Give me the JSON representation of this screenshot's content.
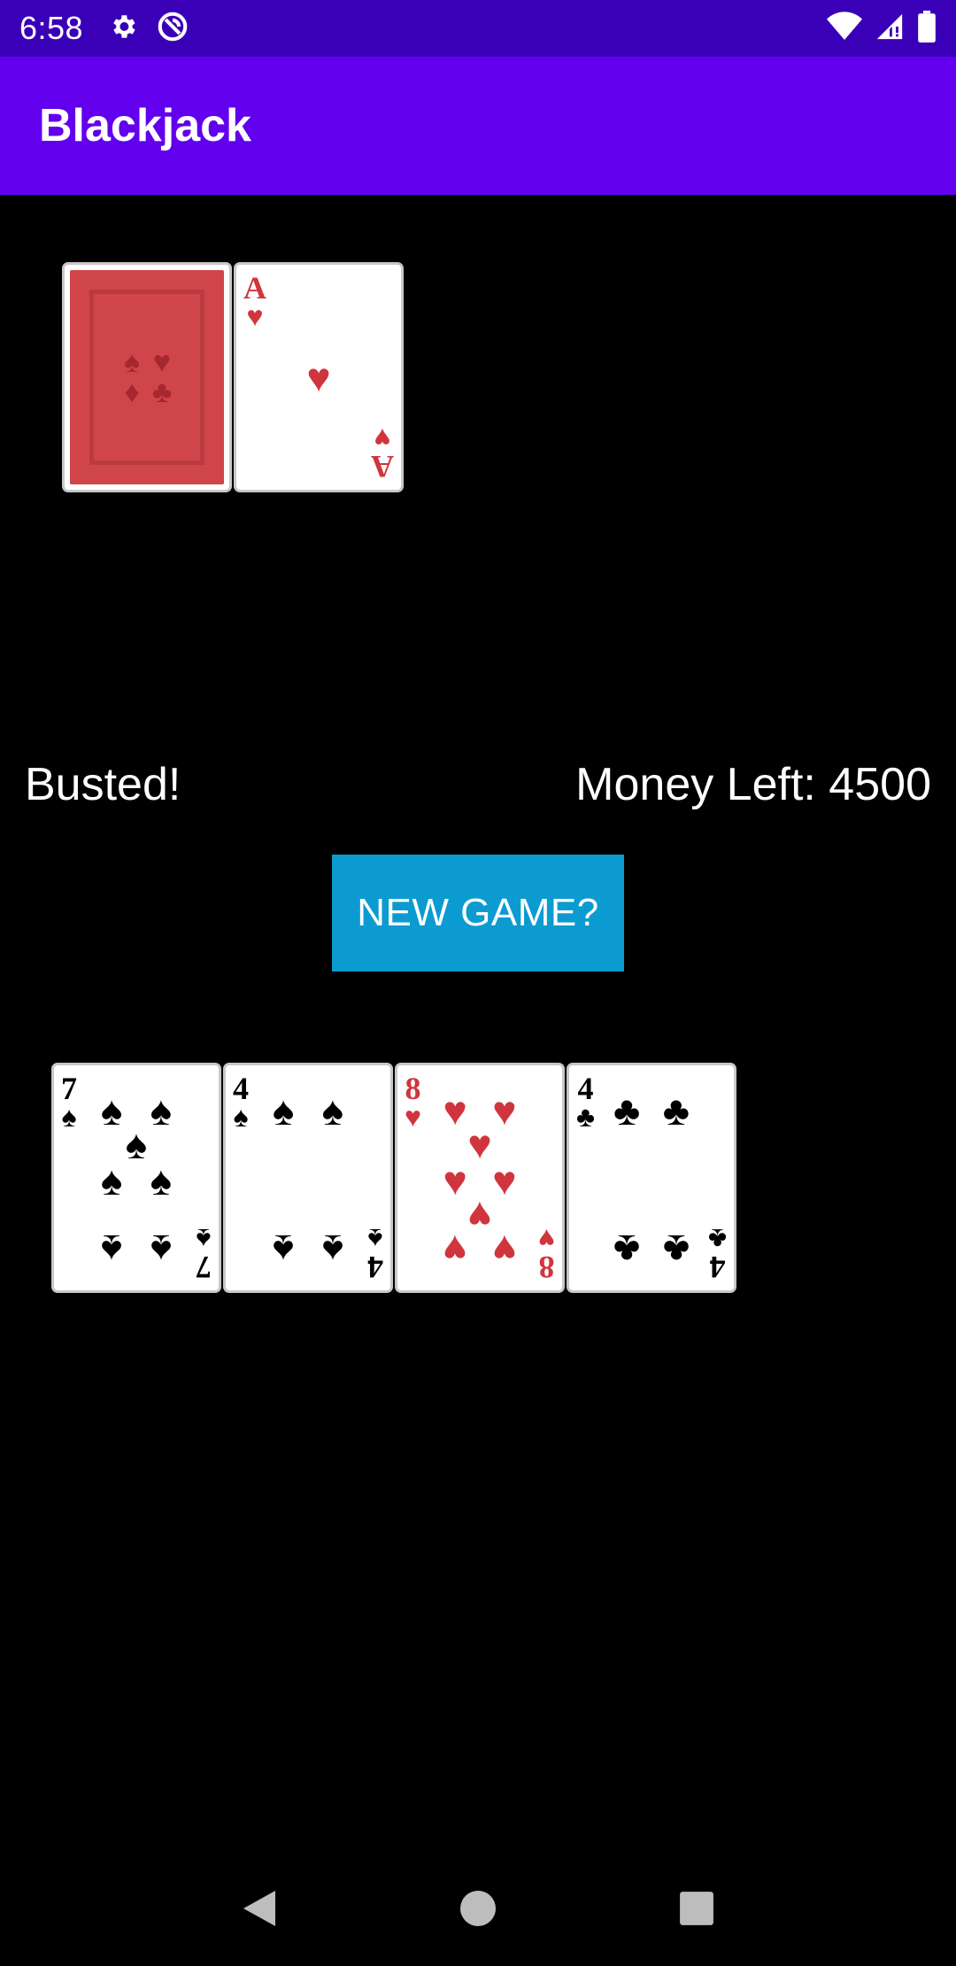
{
  "status_bar": {
    "time": "6:58",
    "left_icons": [
      "gear-icon",
      "vpn-icon"
    ],
    "right_icons": [
      "wifi-icon",
      "cell-signal-icon",
      "battery-icon"
    ]
  },
  "app_bar": {
    "title": "Blackjack",
    "color": "#6200ee"
  },
  "dealer_hand": [
    {
      "face_down": true
    },
    {
      "rank": "A",
      "suit": "♥",
      "color": "red"
    }
  ],
  "game": {
    "status": "Busted!",
    "money_left": "Money Left: 4500",
    "new_game_label": "NEW GAME?",
    "button_color": "#0b9bd1"
  },
  "player_hand": [
    {
      "rank": "7",
      "suit": "♠",
      "color": "black"
    },
    {
      "rank": "4",
      "suit": "♠",
      "color": "black"
    },
    {
      "rank": "8",
      "suit": "♥",
      "color": "red"
    },
    {
      "rank": "4",
      "suit": "♣",
      "color": "black"
    }
  ],
  "nav_bar": [
    "back-icon",
    "home-icon",
    "recents-icon"
  ]
}
